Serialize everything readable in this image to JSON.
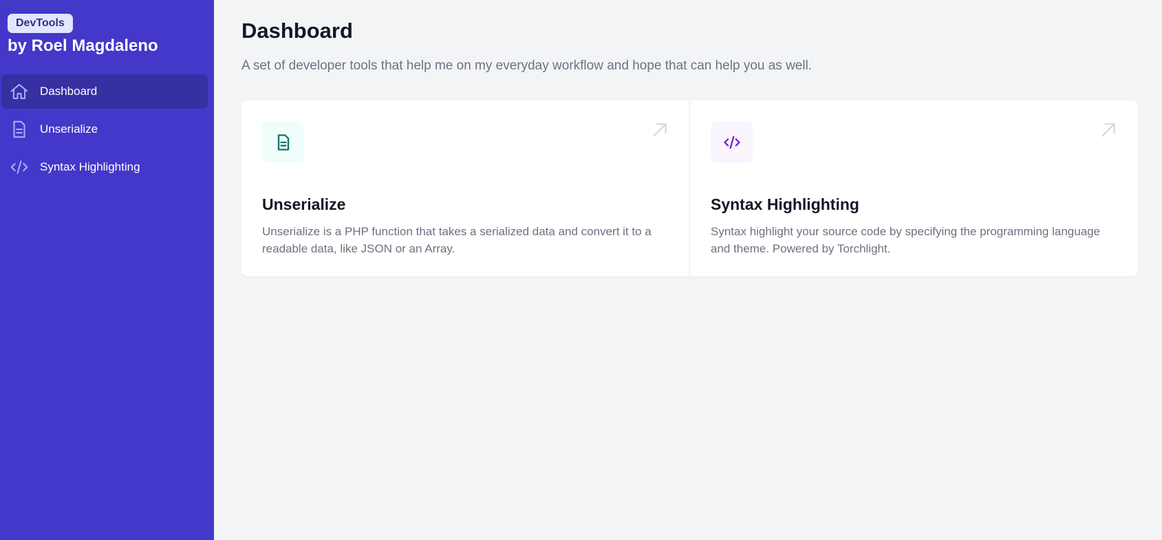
{
  "brand": {
    "badge": "DevTools",
    "title": "by Roel Magdaleno"
  },
  "sidebar": {
    "items": [
      {
        "label": "Dashboard",
        "icon": "home-icon",
        "active": true
      },
      {
        "label": "Unserialize",
        "icon": "document-icon",
        "active": false
      },
      {
        "label": "Syntax Highlighting",
        "icon": "code-icon",
        "active": false
      }
    ]
  },
  "main": {
    "title": "Dashboard",
    "subtitle": "A set of developer tools that help me on my everyday workflow and hope that can help you as well.",
    "cards": [
      {
        "title": "Unserialize",
        "description": "Unserialize is a PHP function that takes a serialized data and convert it to a readable data, like JSON or an Array.",
        "icon": "document-icon",
        "icon_bg": "#f0fdfa",
        "icon_color": "#0f766e"
      },
      {
        "title": "Syntax Highlighting",
        "description": "Syntax highlight your source code by specifying the programming language and theme. Powered by Torchlight.",
        "icon": "code-icon",
        "icon_bg": "#faf5ff",
        "icon_color": "#7e22ce"
      }
    ]
  },
  "colors": {
    "sidebar_bg": "#4338ca",
    "sidebar_active": "#3730a3",
    "page_bg": "#f3f4f6"
  }
}
